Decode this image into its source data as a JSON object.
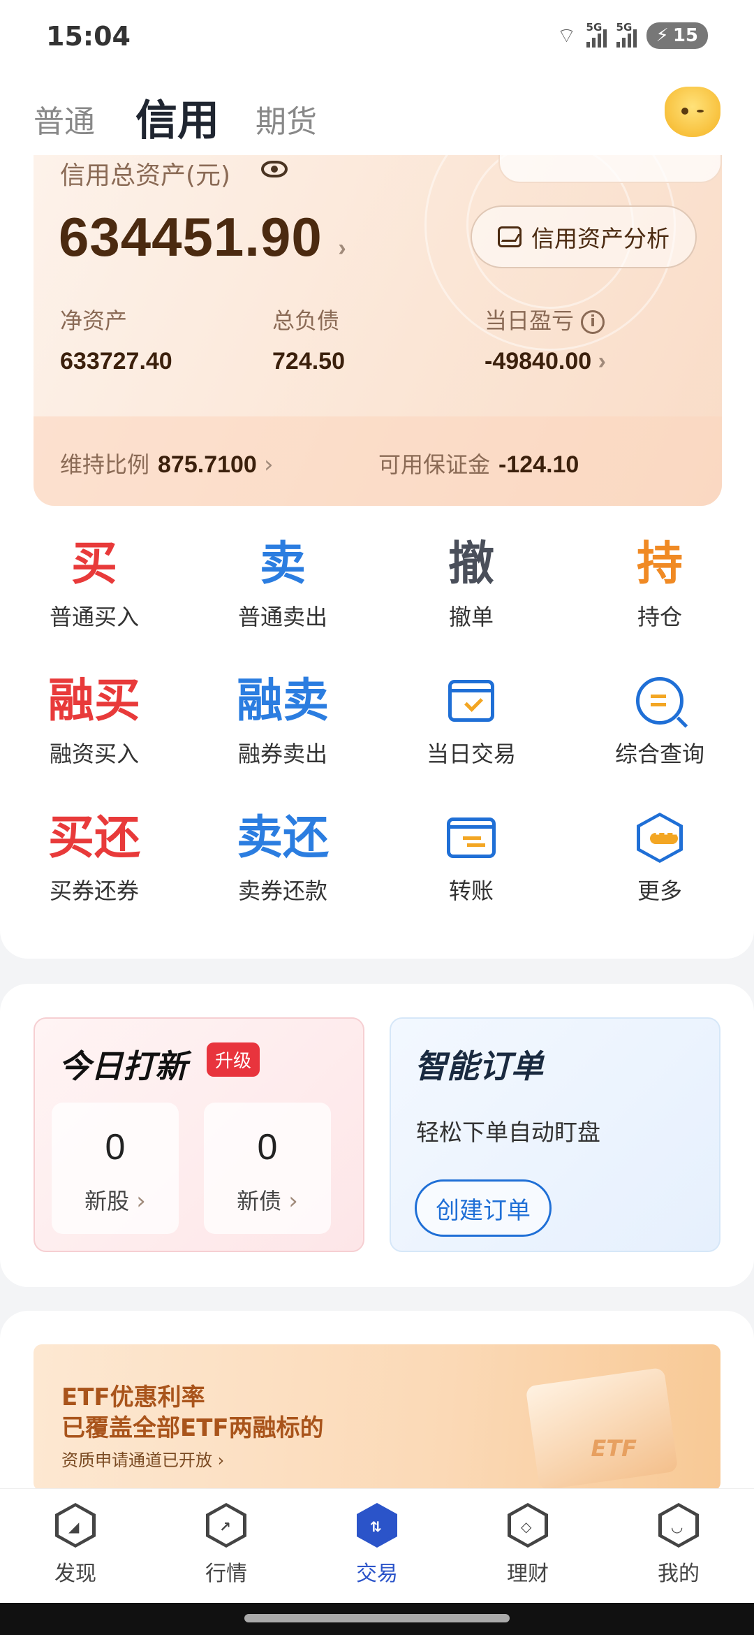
{
  "status": {
    "time": "15:04",
    "net1": "5G",
    "net2": "5G",
    "battery": "15"
  },
  "tabs": [
    "普通",
    "信用",
    "期货"
  ],
  "asset": {
    "label": "信用总资产(元)",
    "total": "634451.90",
    "analysis_button": "信用资产分析",
    "net_assets_label": "净资产",
    "net_assets": "633727.40",
    "total_liab_label": "总负债",
    "total_liab": "724.50",
    "daily_pnl_label": "当日盈亏",
    "daily_pnl": "-49840.00",
    "maint_ratio_label": "维持比例",
    "maint_ratio": "875.7100",
    "avail_margin_label": "可用保证金",
    "avail_margin": "-124.10"
  },
  "actions": [
    {
      "big": "买",
      "label": "普通买入",
      "color": "#e83a3a"
    },
    {
      "big": "卖",
      "label": "普通卖出",
      "color": "#2b7de0"
    },
    {
      "big": "撤",
      "label": "撤单",
      "color": "#4a4f5a"
    },
    {
      "big": "持",
      "label": "持仓",
      "color": "#f08a24"
    },
    {
      "big": "融买",
      "label": "融资买入",
      "color": "#e83a3a"
    },
    {
      "big": "融卖",
      "label": "融券卖出",
      "color": "#2b7de0"
    },
    {
      "icon": "calendar-icon",
      "label": "当日交易"
    },
    {
      "icon": "search-query-icon",
      "label": "综合查询"
    },
    {
      "big": "买还",
      "label": "买券还券",
      "color": "#e83a3a"
    },
    {
      "big": "卖还",
      "label": "卖券还款",
      "color": "#2b7de0"
    },
    {
      "icon": "transfer-icon",
      "label": "转账"
    },
    {
      "icon": "more-icon",
      "label": "更多"
    }
  ],
  "ipo": {
    "title": "今日打新",
    "badge": "升级",
    "new_stock_count": "0",
    "new_stock_label": "新股",
    "new_bond_count": "0",
    "new_bond_label": "新债"
  },
  "smart_order": {
    "title": "智能订单",
    "desc": "轻松下单自动盯盘",
    "button": "创建订单"
  },
  "banner": {
    "line1": "ETF优惠利率",
    "line2": "已覆盖全部ETF两融标的",
    "line3": "资质申请通道已开放",
    "box_label": "ETF"
  },
  "nav": [
    {
      "label": "发现",
      "icon": "compass-icon"
    },
    {
      "label": "行情",
      "icon": "trend-icon"
    },
    {
      "label": "交易",
      "icon": "trade-icon"
    },
    {
      "label": "理财",
      "icon": "wealth-icon"
    },
    {
      "label": "我的",
      "icon": "profile-icon"
    }
  ],
  "colors": {
    "accent": "#2b54c9",
    "red": "#e83a3a",
    "blue": "#2b7de0",
    "orange": "#f08a24"
  }
}
